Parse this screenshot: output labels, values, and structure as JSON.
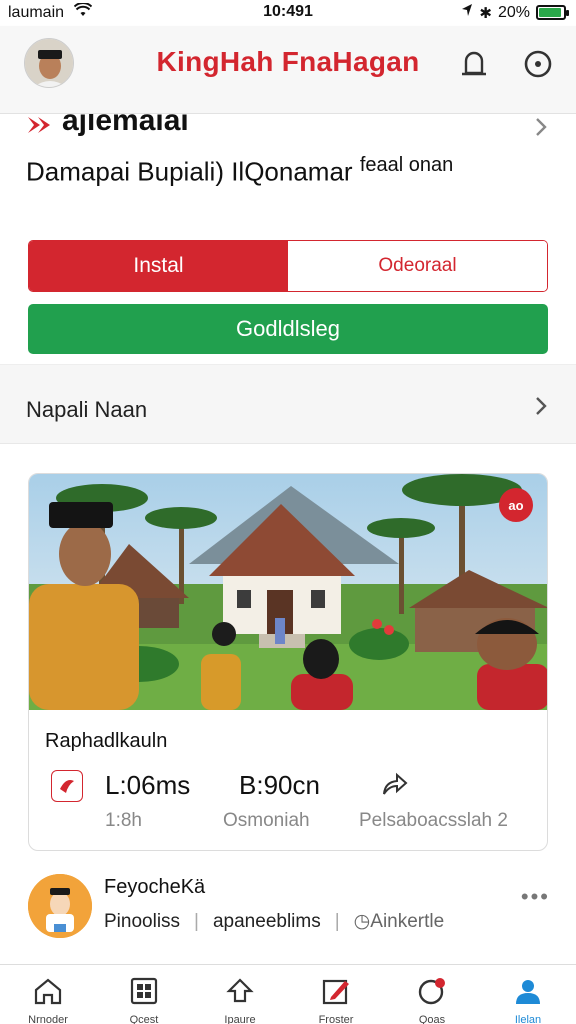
{
  "status_bar": {
    "carrier": "laumain",
    "time": "10:491",
    "battery": "20%",
    "battery_level": 0.9
  },
  "header": {
    "title": "KingHah FnaHagan"
  },
  "hero": {
    "brand": "ajlemaiai",
    "subtitle": "Damapai Bupiali) IlQonamar",
    "subtitle_small": "feaal onan",
    "segment_left": "Instal",
    "segment_right": "Odeoraal",
    "cta_label": "Godldlsleg"
  },
  "nav_row": {
    "label": "Napali Naan"
  },
  "card": {
    "badge": "ao",
    "title": "Raphadlkauln",
    "stats": [
      {
        "value": "L:06ms",
        "label": "1:8h"
      },
      {
        "value": "B:90cn",
        "label": "Osmoniah"
      },
      {
        "value": "",
        "label": "Pelsaboacsslah  2"
      }
    ]
  },
  "post": {
    "name": "FeyocheKä",
    "meta_1": "Pinooliss",
    "meta_2": "apaneeblims",
    "meta_3": "Ainkertle"
  },
  "tabs": [
    {
      "label": "Nrnoder",
      "icon": "home-icon"
    },
    {
      "label": "Qcest",
      "icon": "grid-icon"
    },
    {
      "label": "Ipaure",
      "icon": "explore-icon"
    },
    {
      "label": "Froster",
      "icon": "edit-icon"
    },
    {
      "label": "Qoas",
      "icon": "notification-icon"
    },
    {
      "label": "Ilelan",
      "icon": "profile-icon"
    }
  ],
  "colors": {
    "brand_red": "#d3262f",
    "cta_green": "#21a04e",
    "active_blue": "#1e8ad6"
  }
}
